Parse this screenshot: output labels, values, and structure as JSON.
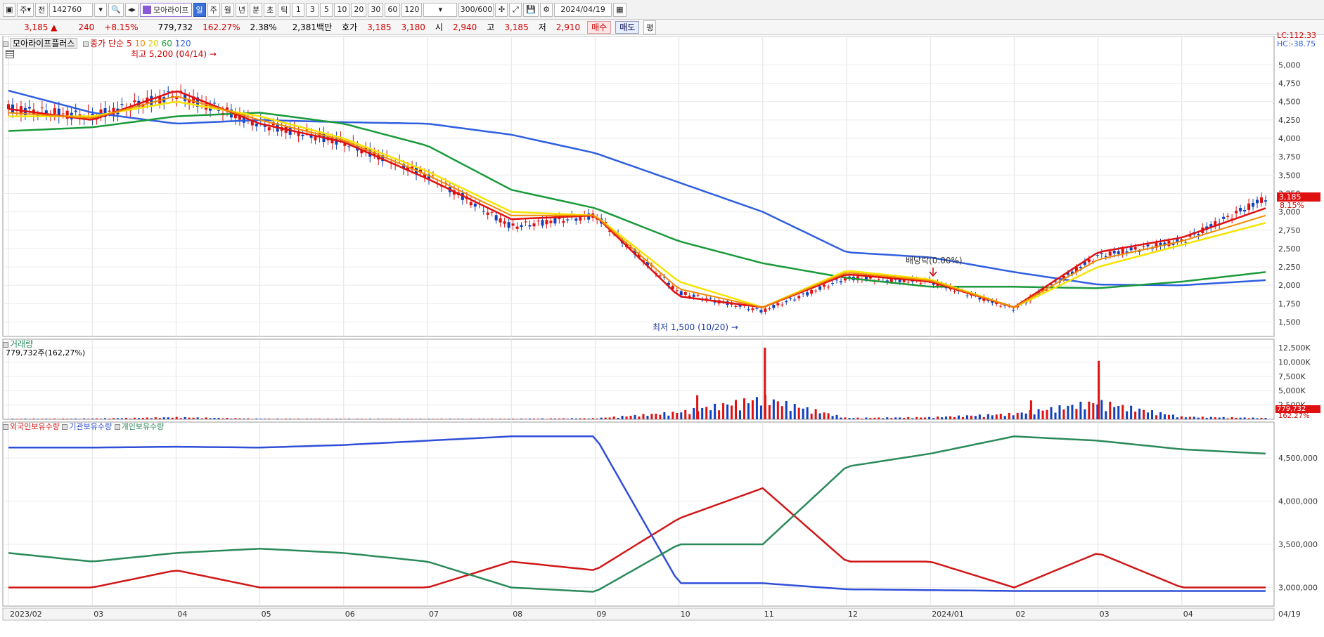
{
  "toolbar": {
    "period_mode": "주",
    "prev_label": "전",
    "code": "142760",
    "stock_name": "모아라이프",
    "tabs": [
      "일",
      "주",
      "월",
      "년",
      "분",
      "초",
      "틱"
    ],
    "active_tab": "일",
    "numbers": [
      "1",
      "3",
      "5",
      "10",
      "20",
      "30",
      "60",
      "120"
    ],
    "count": "300/600",
    "date": "2024/04/19"
  },
  "quote": {
    "price": "3,185 ▲",
    "change": "240",
    "rate": "+8.15%",
    "volume": "779,732",
    "vol_ratio": "162.27%",
    "turnover": "2.38%",
    "amount": "2,381백만",
    "bid_label": "호가",
    "ask": "3,185",
    "bid": "3,180",
    "open_label": "시",
    "open": "2,940",
    "high_label": "고",
    "high": "3,185",
    "low_label": "저",
    "low": "2,910",
    "buy_label": "매수",
    "sell_label": "매도",
    "eval_label": "평"
  },
  "price_panel": {
    "title": "모아라이프플러스",
    "ma_label": "종가 단순",
    "ma_periods": [
      "5",
      "10",
      "20",
      "60",
      "120"
    ],
    "high_marker": "최고 5,200 (04/14)",
    "low_marker": "최저 1,500 (10/20)",
    "dividend_marker": "배당락(0.00%)",
    "lc_label": "LC:112.33",
    "hc_label": "HC:-38.75",
    "price_tag": "3,185",
    "rate_tag": "8.15%",
    "y_ticks": [
      "5,000",
      "4,750",
      "4,500",
      "4,250",
      "4,000",
      "3,750",
      "3,500",
      "3,250",
      "3,000",
      "2,750",
      "2,500",
      "2,250",
      "2,000",
      "1,750",
      "1,500"
    ]
  },
  "volume_panel": {
    "title": "거래량",
    "info": "779,732주(162,27%)",
    "y_ticks": [
      "12,500K",
      "10,000K",
      "7,500K",
      "5,000K",
      "2,500K"
    ],
    "vol_tag": "779,732",
    "ratio_tag": "162.27%"
  },
  "holding_panel": {
    "legend": [
      "외국인보유수량",
      "기관보유수량",
      "개인보유수량"
    ],
    "y_ticks": [
      "4,500,000",
      "4,000,000",
      "3,500,000",
      "3,000,000"
    ]
  },
  "x_labels": [
    "2023/02",
    "03",
    "04",
    "05",
    "06",
    "07",
    "08",
    "09",
    "10",
    "11",
    "12",
    "2024/01",
    "02",
    "03",
    "04",
    "04/19"
  ],
  "colors": {
    "ma5": "#e01010",
    "ma10": "#f08a00",
    "ma20": "#f5e400",
    "ma60": "#1a9a3a",
    "ma120": "#2f5fe0",
    "up": "#e01010",
    "down": "#1040c0",
    "foreign": "#d01818",
    "institution": "#2f4fd8",
    "individual": "#2a8a5a"
  },
  "chart_data": {
    "type": "line",
    "x": [
      "2023/02",
      "03",
      "04",
      "05",
      "06",
      "07",
      "08",
      "09",
      "10",
      "11",
      "12",
      "2024/01",
      "02",
      "03",
      "04",
      "04/19"
    ],
    "series": [
      {
        "name": "종가",
        "values": [
          4400,
          4300,
          4600,
          4200,
          3950,
          3500,
          2800,
          2950,
          1900,
          1650,
          2100,
          2050,
          1680,
          2400,
          2600,
          3185
        ]
      },
      {
        "name": "5",
        "values": [
          4400,
          4250,
          4650,
          4200,
          3950,
          3450,
          2900,
          2950,
          1850,
          1700,
          2150,
          2050,
          1700,
          2450,
          2650,
          3050
        ]
      },
      {
        "name": "20",
        "values": [
          4300,
          4300,
          4500,
          4300,
          4000,
          3550,
          3000,
          2950,
          2050,
          1700,
          2200,
          2080,
          1700,
          2250,
          2550,
          2850
        ]
      },
      {
        "name": "60",
        "values": [
          4100,
          4150,
          4300,
          4350,
          4200,
          3900,
          3300,
          3050,
          2600,
          2300,
          2100,
          1980,
          1980,
          1960,
          2050,
          2180
        ]
      },
      {
        "name": "120",
        "values": [
          4650,
          4350,
          4200,
          4250,
          4220,
          4200,
          4050,
          3800,
          3400,
          3000,
          2450,
          2380,
          2180,
          2010,
          2000,
          2070
        ]
      }
    ],
    "volume_k": [
      300,
      420,
      1200,
      350,
      300,
      280,
      320,
      600,
      4200,
      12500,
      800,
      1200,
      3300,
      10200,
      1500,
      780
    ],
    "holdings": [
      {
        "name": "외국인보유수량",
        "values": [
          3000000,
          3000000,
          3200000,
          3000000,
          3000000,
          3000000,
          3300000,
          3200000,
          3800000,
          4150000,
          3300000,
          3300000,
          3000000,
          3400000,
          3000000,
          3000000
        ]
      },
      {
        "name": "기관보유수량",
        "values": [
          4620000,
          4620000,
          4630000,
          4620000,
          4650000,
          4700000,
          4750000,
          4750000,
          3050000,
          3050000,
          2980000,
          2970000,
          2960000,
          2960000,
          2960000,
          2960000
        ]
      },
      {
        "name": "개인보유수량",
        "values": [
          3400000,
          3300000,
          3400000,
          3450000,
          3400000,
          3300000,
          3000000,
          2950000,
          3500000,
          3500000,
          4400000,
          4550000,
          4750000,
          4700000,
          4600000,
          4550000
        ]
      }
    ],
    "ylim_price": [
      1400,
      5300
    ]
  }
}
